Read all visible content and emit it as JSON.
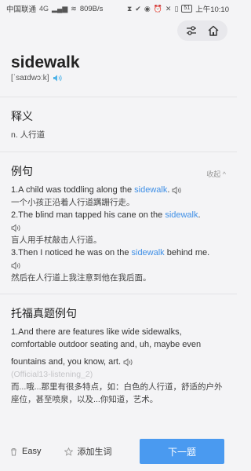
{
  "status_bar": {
    "carrier": "中国联通",
    "network": "4G",
    "speed": "809B/s",
    "battery": "51",
    "time": "上午10:10"
  },
  "word": {
    "headword": "sidewalk",
    "phonetic": "[ˈsaɪdwɔːk]"
  },
  "definition": {
    "title": "释义",
    "text": "n. 人行道"
  },
  "examples": {
    "title": "例句",
    "collapse_label": "收起 ^",
    "items": [
      {
        "pre": "1.A child was toddling along the ",
        "hl": "sidewalk",
        "post": ".",
        "cn": "一个小孩正沿着人行道蹒跚行走。"
      },
      {
        "pre": "2.The blind man tapped his cane on the ",
        "hl": "sidewalk",
        "post": ".",
        "cn": "盲人用手杖敲击人行道。"
      },
      {
        "pre": "3.Then I noticed he was on the ",
        "hl": "sidewalk",
        "post": " behind me.",
        "cn": "然后在人行道上我注意到他在我后面。"
      }
    ]
  },
  "toefl": {
    "title": "托福真题例句",
    "en_line1": "1.And there are features like wide sidewalks, comfortable outdoor seating and, uh, maybe even",
    "en_line2": "fountains and, you know, art.",
    "source": "(Official13-listening_2)",
    "cn": "而...哦...那里有很多特点，如：白色的人行道，舒适的户外座位，甚至喷泉，以及...你知道，艺术。"
  },
  "bottom_bar": {
    "easy_label": "Easy",
    "add_label": "添加生词",
    "next_label": "下一题"
  },
  "colors": {
    "accent": "#4a9af0",
    "highlight": "#3f8fe6"
  }
}
